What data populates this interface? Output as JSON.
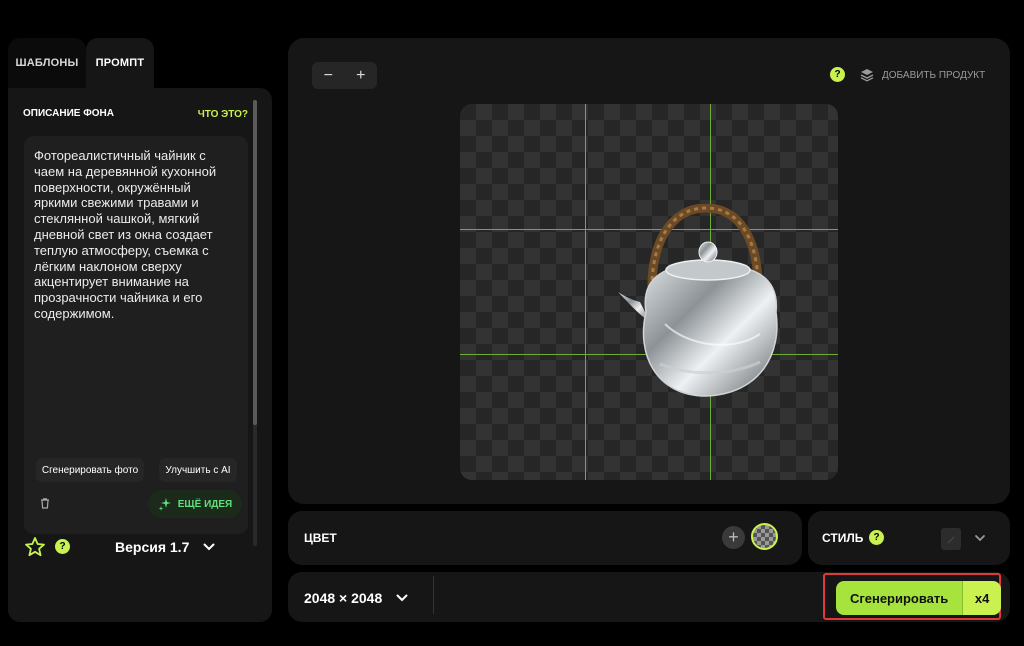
{
  "tabs": {
    "templates": "ШАБЛОНЫ",
    "prompt": "ПРОМПТ"
  },
  "prompt_panel": {
    "title": "ОПИСАНИЕ ФОНА",
    "what_is_it": "ЧТО ЭТО?",
    "text": "Фотореалистичный чайник с чаем на деревянной кухонной поверхности, окружённый яркими свежими травами и стеклянной чашкой, мягкий дневной свет из окна создает теплую атмосферу, съемка с лёгким наклоном сверху акцентирует внимание на прозрачности чайника и его содержимом.",
    "generate_photo_button": "Сгенерировать фото",
    "improve_ai_button": "Улучшить с AI",
    "more_ideas_button": "ЕЩЁ ИДЕЯ",
    "help": "?",
    "version": "Версия 1.7"
  },
  "canvas": {
    "zoom_out": "−",
    "zoom_in": "+",
    "help": "?",
    "add_product": "ДОБАВИТЬ ПРОДУКТ"
  },
  "color_panel": {
    "label": "ЦВЕТ",
    "add": "+"
  },
  "style_panel": {
    "label": "СТИЛЬ",
    "help": "?"
  },
  "bottom_bar": {
    "size": "2048 × 2048",
    "generate": "Сгенерировать",
    "multiplier": "x4"
  },
  "colors": {
    "accent": "#c9f150",
    "generate_button": "#a6e33c",
    "highlight_border": "#e0393b",
    "panel": "#161616",
    "guide_lines": "#6fae35"
  }
}
